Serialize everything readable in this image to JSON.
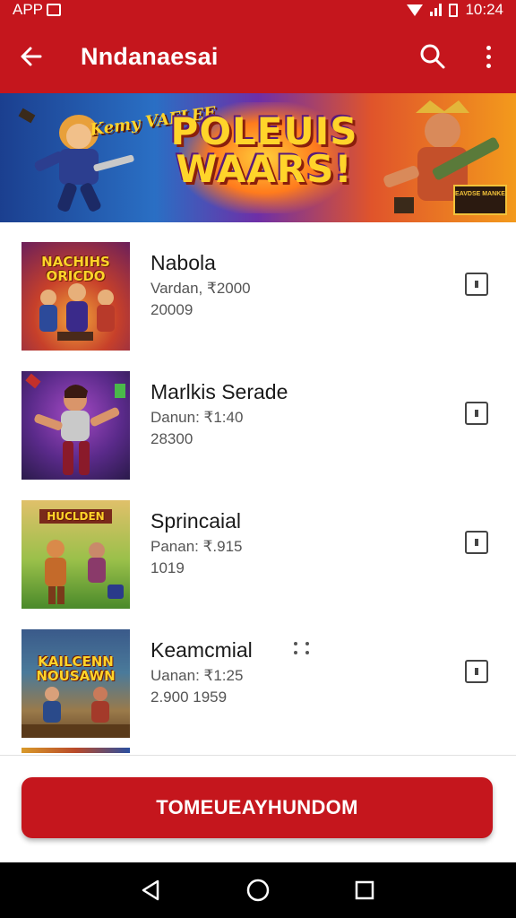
{
  "status_bar": {
    "left_text": "APP",
    "time": "10:24"
  },
  "app_bar": {
    "title": "Nndanaesai",
    "back_icon": "arrow-left-icon",
    "search_icon": "search-icon",
    "more_icon": "more-vert-icon"
  },
  "banner": {
    "title": "POLEUIS WAARS!",
    "subtitle": "Kemy VAFLEE",
    "badge": "EAVDSE MANKE"
  },
  "list": {
    "items": [
      {
        "title": "Nabola",
        "line1": "Vardan, ₹2000",
        "line2": "20009"
      },
      {
        "title": "Marlkis Serade",
        "line1": "Danun: ₹1:40",
        "line2": "28300"
      },
      {
        "title": "Sprincaial",
        "line1": "Panan: ₹.915",
        "line2": "1019"
      },
      {
        "title": "Keamcmial",
        "line1": "Uanan: ₹1:25",
        "line2": "2.900 1959"
      }
    ],
    "thumb_texts": [
      "NACHIHS ORICDO",
      "",
      "HUCLDEN",
      "KAILCENN NOUSAWN"
    ]
  },
  "cta": {
    "label": "TOMEUEAYHUNDOM"
  },
  "colors": {
    "primary": "#c5161d",
    "text": "#1a1a1a",
    "secondary_text": "#555555"
  }
}
